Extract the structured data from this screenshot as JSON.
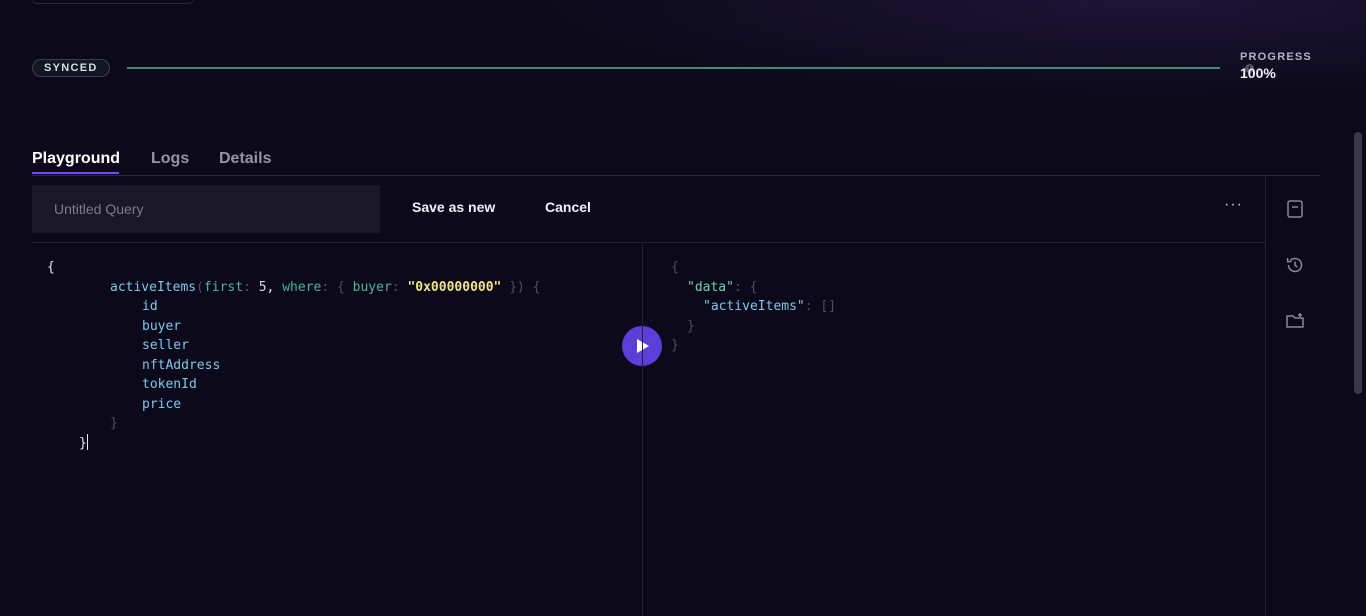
{
  "status": {
    "badge": "SYNCED",
    "progress_label": "PROGRESS",
    "progress_value": "100%",
    "progress_fraction": 1.0
  },
  "tabs": [
    {
      "label": "Playground",
      "active": true
    },
    {
      "label": "Logs",
      "active": false
    },
    {
      "label": "Details",
      "active": false
    }
  ],
  "toolbar": {
    "query_name_placeholder": "Untitled Query",
    "query_name_value": "",
    "save_as_new_label": "Save as new",
    "cancel_label": "Cancel",
    "more_label": "···"
  },
  "query": {
    "open": "{",
    "entity": "activeItems",
    "arg_first_key": "first",
    "arg_first_value": "5",
    "arg_where_key": "where",
    "arg_buyer_key": "buyer",
    "arg_buyer_value": "\"0x00000000\"",
    "fields": [
      "id",
      "buyer",
      "seller",
      "nftAddress",
      "tokenId",
      "price"
    ],
    "inner_close": "}",
    "close": "}"
  },
  "result": {
    "open": "{",
    "data_key": "\"data\"",
    "items_key": "\"activeItems\"",
    "items_value": "[]",
    "inner_close": "}",
    "close": "}"
  },
  "rail_icons": [
    "bookmark-icon",
    "history-icon",
    "folder-add-icon"
  ],
  "colors": {
    "accent": "#6f4cff",
    "run_button": "#5a3fd9",
    "progress": "#3f8d6e"
  }
}
